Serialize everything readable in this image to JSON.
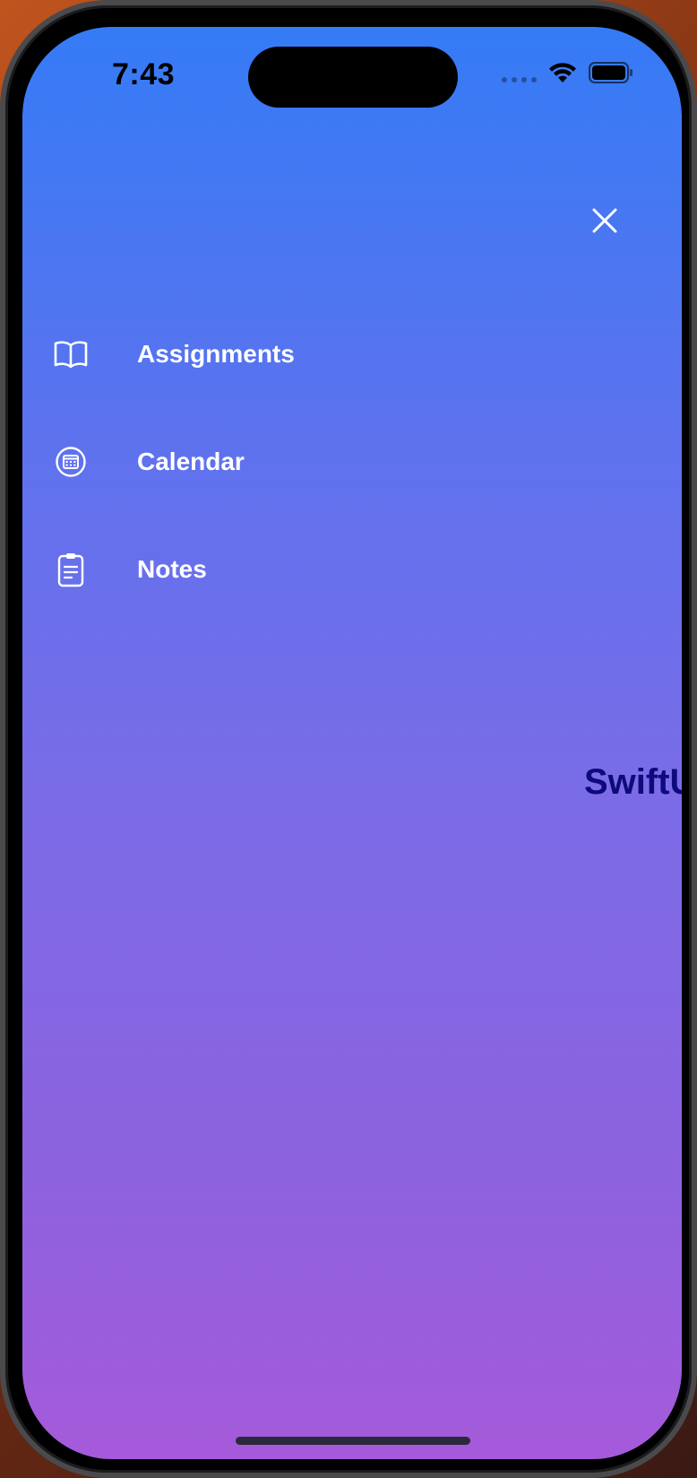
{
  "status_bar": {
    "time": "7:43",
    "wifi_icon": "wifi-icon",
    "battery_icon": "battery-icon"
  },
  "header": {
    "close_icon": "close-icon"
  },
  "menu": {
    "items": [
      {
        "label": "Assignments",
        "icon": "book-icon"
      },
      {
        "label": "Calendar",
        "icon": "calendar-icon"
      },
      {
        "label": "Notes",
        "icon": "clipboard-icon"
      }
    ]
  },
  "background_content": {
    "title_fragment": "SwiftU"
  },
  "colors": {
    "gradient_top": "#357bf6",
    "gradient_bottom": "#a55ada",
    "menu_text": "#ffffff",
    "background_title": "#0e0a7a"
  }
}
